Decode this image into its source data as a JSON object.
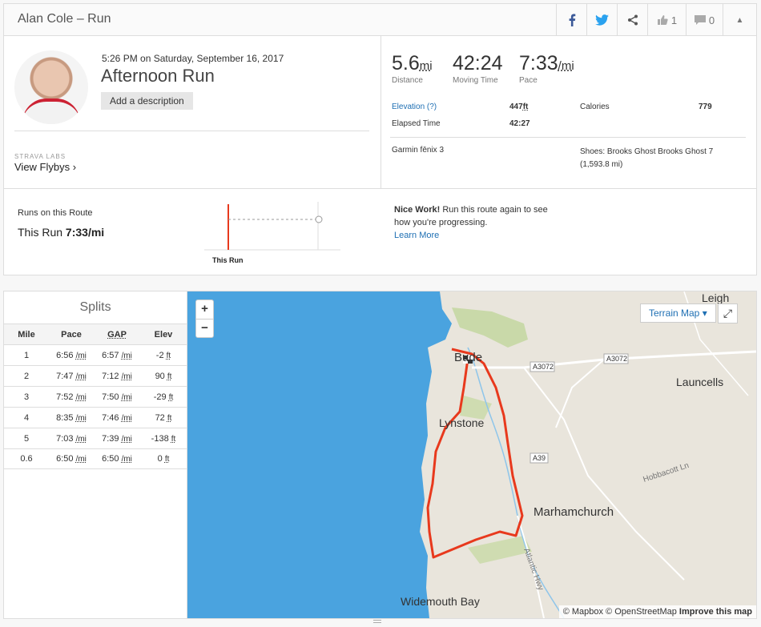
{
  "header": {
    "title": "Alan Cole – Run",
    "kudos_count": "1",
    "comment_count": "0"
  },
  "activity": {
    "datetime": "5:26 PM on Saturday, September 16, 2017",
    "name": "Afternoon Run",
    "add_description": "Add a description",
    "labs": "STRAVA LABS",
    "flybys": "View Flybys ›"
  },
  "stats": {
    "distance_value": "5.6",
    "distance_unit": "mi",
    "distance_label": "Distance",
    "time_value": "42:24",
    "time_label": "Moving Time",
    "pace_value": "7:33",
    "pace_unit": "/mi",
    "pace_label": "Pace",
    "elevation_label": "Elevation (?)",
    "elevation_value": "447",
    "elevation_unit": "ft",
    "calories_label": "Calories",
    "calories_value": "779",
    "elapsed_label": "Elapsed Time",
    "elapsed_value": "42:27",
    "device": "Garmin fēnix 3",
    "shoes": "Shoes: Brooks Ghost Brooks Ghost 7 (1,593.8 mi)"
  },
  "route": {
    "runs_label": "Runs on this Route",
    "this_run_prefix": "This Run ",
    "this_run_pace": "7:33/mi",
    "chart_label": "This Run",
    "nice_bold": "Nice Work!",
    "nice_text": " Run this route again to see how you're progressing.",
    "learn_more": "Learn More"
  },
  "splits": {
    "title": "Splits",
    "headers": [
      "Mile",
      "Pace",
      "GAP",
      "Elev"
    ],
    "rows": [
      {
        "mile": "1",
        "pace": "6:56",
        "gap": "6:57",
        "elev": "-2"
      },
      {
        "mile": "2",
        "pace": "7:47",
        "gap": "7:12",
        "elev": "90"
      },
      {
        "mile": "3",
        "pace": "7:52",
        "gap": "7:50",
        "elev": "-29"
      },
      {
        "mile": "4",
        "pace": "8:35",
        "gap": "7:46",
        "elev": "72"
      },
      {
        "mile": "5",
        "pace": "7:03",
        "gap": "7:39",
        "elev": "-138"
      },
      {
        "mile": "0.6",
        "pace": "6:50",
        "gap": "6:50",
        "elev": "0"
      }
    ],
    "pace_unit": "/mi",
    "elev_unit": "ft"
  },
  "map": {
    "terrain_label": "Terrain Map ▾",
    "places": [
      "Leigh",
      "Bude",
      "Launcells",
      "Lynstone",
      "Marhamchurch",
      "Widemouth Bay",
      "Hobbacott Ln",
      "Atlantic Hwy"
    ],
    "roads": [
      "A3072",
      "A3072",
      "A39"
    ],
    "attribution_1": "© Mapbox © OpenStreetMap ",
    "attribution_2": "Improve this map",
    "route_color": "#e8391d",
    "sea_color": "#4aa3df"
  }
}
